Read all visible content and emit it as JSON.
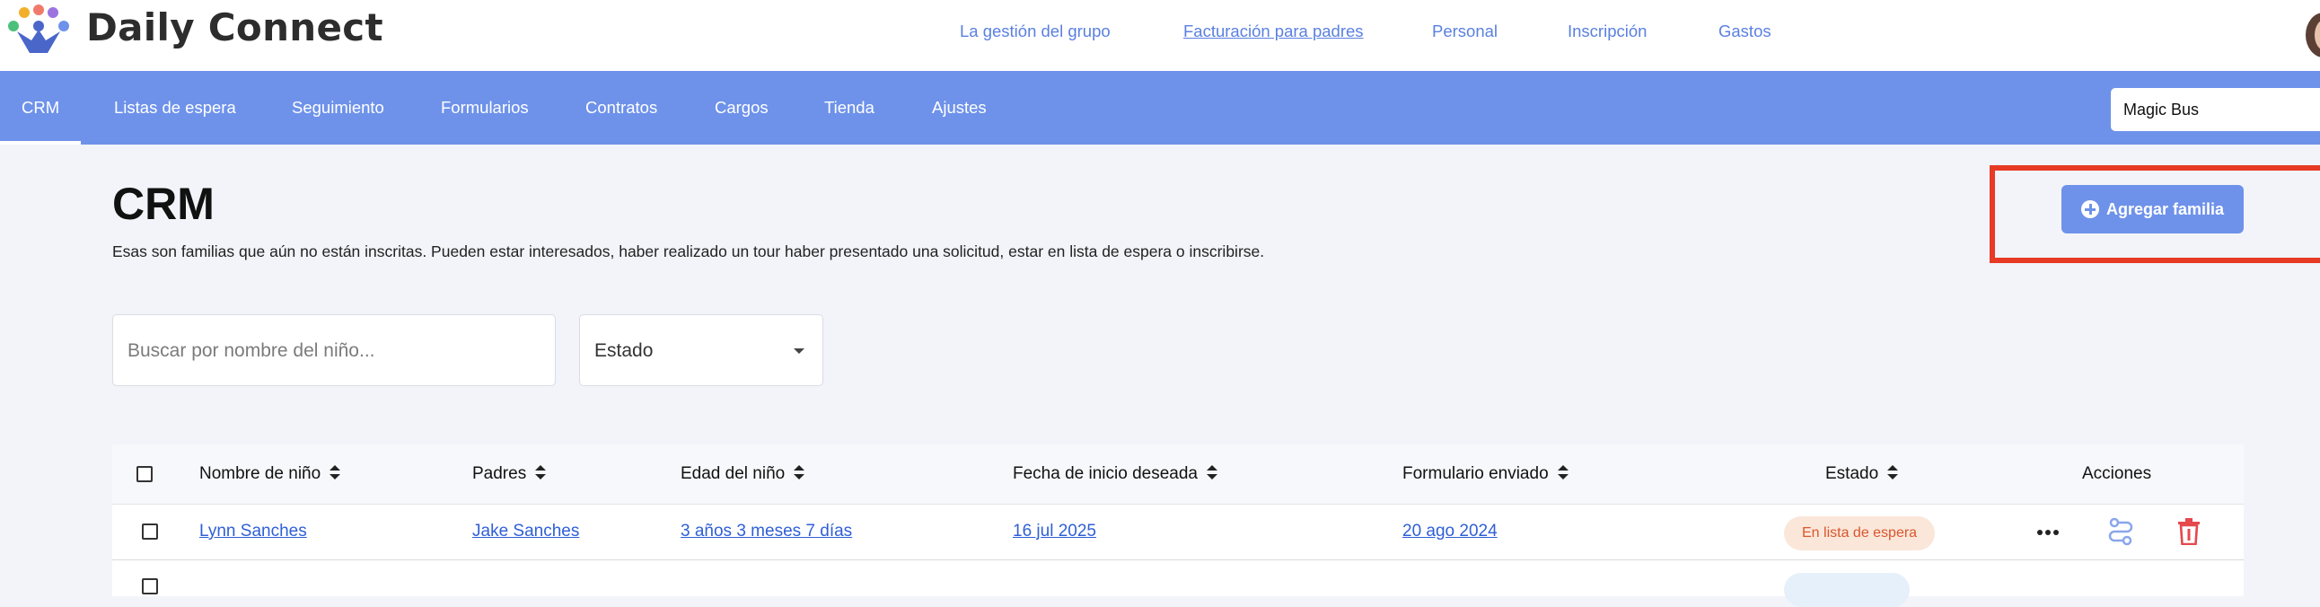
{
  "brand": {
    "name": "Daily Connect"
  },
  "topnav": [
    {
      "label": "La gestión del grupo",
      "active": false
    },
    {
      "label": "Facturación para padres",
      "active": true
    },
    {
      "label": "Personal",
      "active": false
    },
    {
      "label": "Inscripción",
      "active": false
    },
    {
      "label": "Gastos",
      "active": false
    }
  ],
  "subnav": [
    {
      "label": "CRM",
      "active": true
    },
    {
      "label": "Listas de espera"
    },
    {
      "label": "Seguimiento"
    },
    {
      "label": "Formularios"
    },
    {
      "label": "Contratos"
    },
    {
      "label": "Cargos"
    },
    {
      "label": "Tienda"
    },
    {
      "label": "Ajustes"
    }
  ],
  "school_select": {
    "value": "Magic Bus"
  },
  "page": {
    "title": "CRM",
    "subtitle": "Esas son familias que aún no están inscritas. Pueden estar interesados, haber realizado un tour haber presentado una solicitud, estar en lista de espera o inscribirse.",
    "add_button": "Agregar familia"
  },
  "filters": {
    "search_placeholder": "Buscar por nombre del niño...",
    "status_label": "Estado"
  },
  "table": {
    "columns": [
      "Nombre de niño",
      "Padres",
      "Edad del niño",
      "Fecha de inicio deseada",
      "Formulario enviado",
      "Estado",
      "Acciones"
    ],
    "rows": [
      {
        "child": "Lynn Sanches",
        "parent": "Jake Sanches",
        "age": "3 años 3 meses 7 días",
        "start": "16 jul 2025",
        "form_sent": "20 ago 2024",
        "status": "En lista de espera"
      }
    ]
  },
  "colors": {
    "primary": "#6e92ea",
    "link": "#2f5fd6",
    "danger": "#e5484d",
    "highlight": "#e63a25",
    "waitlist_badge_bg": "#fbe6da",
    "waitlist_badge_text": "#d9572b"
  },
  "icons": [
    "logo-people-icon",
    "plus-circle-icon",
    "sort-icon",
    "more-dots-icon",
    "route-icon",
    "trash-icon",
    "chevron-down-icon"
  ]
}
